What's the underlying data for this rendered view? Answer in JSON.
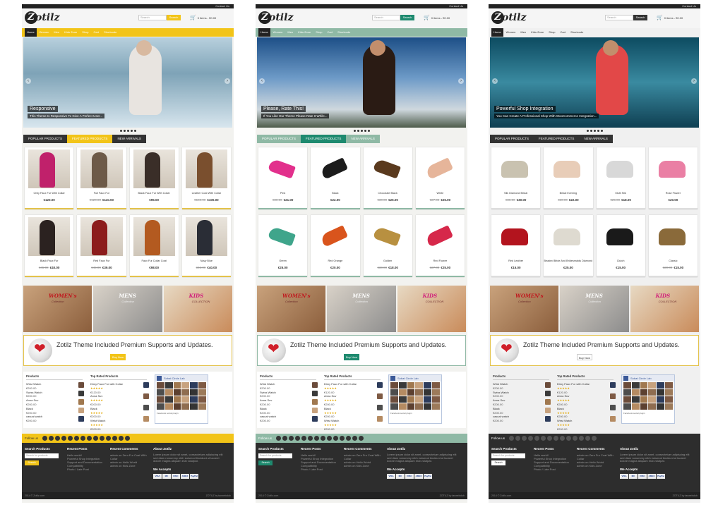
{
  "themes": [
    {
      "accent": "#f2c418",
      "nav_bg": "#f2c418",
      "contact": "Contact Us",
      "search_placeholder": "Search",
      "search_btn": "Search",
      "cart": "0 items - €0.00",
      "nav": [
        "Home",
        "Women",
        "Men",
        "Kids Zone",
        "Shop",
        "Cart",
        "Shortcode"
      ],
      "slide_title": "Responsive",
      "slide_sub": "This Theme Is Responsive To Give A Perfect User...",
      "tabs": [
        "POPULAR PRODUCTS",
        "FEATURED PRODUCTS",
        "NEW ARRIVALS"
      ],
      "products": [
        {
          "name": "Chily Faux Fur With Collar",
          "old": "",
          "price": "€120.00",
          "tone": "#c0216b"
        },
        {
          "name": "Full Faux Fur",
          "old": "€120.00",
          "price": "€110.00",
          "tone": "#6d5a48"
        },
        {
          "name": "Black Faux Fur With Collar",
          "old": "",
          "price": "€95.00",
          "tone": "#3a2e28"
        },
        {
          "name": "Leather Coat With Collar",
          "old": "€160.00",
          "price": "€100.00",
          "tone": "#7a4f2e"
        },
        {
          "name": "Black Faux Fur",
          "old": "€45.00",
          "price": "€40.00",
          "tone": "#2b2220"
        },
        {
          "name": "Red Faux Fur",
          "old": "€45.00",
          "price": "€39.00",
          "tone": "#8c1c1c"
        },
        {
          "name": "Faux Fur Collar Coat",
          "old": "",
          "price": "€98.00",
          "tone": "#b35a20"
        },
        {
          "name": "Navy Blue",
          "old": "€45.00",
          "price": "€40.00",
          "tone": "#2a2d36"
        }
      ],
      "promo": "Zotilz Theme Included Premium Supports and Updates.",
      "buy": "Buy Now",
      "widgets": {
        "products_title": "Products",
        "top_title": "Top Rated Products",
        "products": [
          {
            "n": "Wrist Watch",
            "p": "€200.00"
          },
          {
            "n": "Swiss Watch",
            "p": "€200.00"
          },
          {
            "n": "Anna Suv",
            "p": "€200.00"
          },
          {
            "n": "Black",
            "p": "€200.00"
          },
          {
            "n": "casual watch",
            "p": "€200.00"
          }
        ],
        "top": [
          {
            "n": "Dimy Faux Fur with Collar",
            "p": "€120.00"
          },
          {
            "n": "Anna Suv",
            "p": "€200.00"
          },
          {
            "n": "Black",
            "p": "€200.00"
          },
          {
            "n": "Wrist Watch",
            "p": "€200.00"
          }
        ],
        "fb_title": "Sobat Circle Lab",
        "fb_sub": "Facebook social plugin"
      },
      "follow": "Follow us",
      "footer": {
        "search_title": "Search Products",
        "search_ph": "Search for products",
        "search_btn": "Search",
        "posts_title": "Recent Posts",
        "posts": [
          "Hello world!",
          "Powerful Shop Integration",
          "Support and Documentation",
          "Compatibility",
          "Photo / Late Post"
        ],
        "comments_title": "Recent Comments",
        "comments": [
          "admin on Zero Fur Coat With Collar",
          "admin on Hello World",
          "admin on Kids Zone"
        ],
        "about_title": "About Zotilz",
        "about": "Lorem ipsum dolor sit amet, consectetuer adipiscing elit sed diam nonummy nibh euismod tincidunt ut laoreet dolore magna aliquam erat volutpat.",
        "accepts": "We Accepts",
        "pay": [
          "VISA",
          "MC",
          "DISC",
          "AMEX",
          "PayPal"
        ],
        "copy_l": "2014 © Zotilz.com",
        "copy_r": "ZOTILZ by tanwebclub"
      }
    },
    {
      "accent": "#1e8a6f",
      "nav_bg": "#8fb9a5",
      "contact": "Contact Us",
      "search_placeholder": "Search",
      "search_btn": "Search",
      "cart": "0 items - €0.00",
      "nav": [
        "Home",
        "Women",
        "Men",
        "Kids Zone",
        "Shop",
        "Cart",
        "Shortcode"
      ],
      "slide_title": "Please, Rate This!",
      "slide_sub": "If You Like Our Theme Please Rate It While...",
      "tabs": [
        "POPULAR PRODUCTS",
        "FEATURED PRODUCTS",
        "NEW ARRIVALS"
      ],
      "products": [
        {
          "name": "Pink",
          "old": "€30.00",
          "price": "€21.00",
          "tone": "#e2308c"
        },
        {
          "name": "Black",
          "old": "",
          "price": "€22.00",
          "tone": "#1c1c1c"
        },
        {
          "name": "Chocolate Black",
          "old": "€30.00",
          "price": "€25.00",
          "tone": "#5a3a1e"
        },
        {
          "name": "White",
          "old": "€27.00",
          "price": "€25.00",
          "tone": "#e6b59a"
        },
        {
          "name": "Green",
          "old": "",
          "price": "€25.00",
          "tone": "#3fa58b"
        },
        {
          "name": "Red Orange",
          "old": "",
          "price": "€20.00",
          "tone": "#d9541c"
        },
        {
          "name": "Golden",
          "old": "€30.00",
          "price": "€18.00",
          "tone": "#b89040"
        },
        {
          "name": "Red Flower",
          "old": "€27.00",
          "price": "€25.00",
          "tone": "#d6284a"
        }
      ],
      "promo": "Zotilz Theme Included Premium Supports and Updates.",
      "buy": "Buy Now",
      "widgets": {
        "products_title": "Products",
        "top_title": "Top Rated Products",
        "products": [
          {
            "n": "Wrist Watch",
            "p": "€200.00"
          },
          {
            "n": "Swiss Watch",
            "p": "€200.00"
          },
          {
            "n": "Anna Suv",
            "p": "€200.00"
          },
          {
            "n": "Black",
            "p": "€200.00"
          },
          {
            "n": "casual watch",
            "p": "€200.00"
          }
        ],
        "top": [
          {
            "n": "Dimy Faux Fur with Collar",
            "p": "€120.00"
          },
          {
            "n": "Anna Suv",
            "p": "€200.00"
          },
          {
            "n": "Black",
            "p": "€200.00"
          },
          {
            "n": "Wrist Watch",
            "p": "€200.00"
          }
        ],
        "fb_title": "Sobat Circle Lab",
        "fb_sub": "Facebook social plugin"
      },
      "follow": "Follow us",
      "footer": {
        "search_title": "Search Products",
        "search_ph": "Search for products",
        "search_btn": "Search",
        "posts_title": "Recent Posts",
        "posts": [
          "Hello world!",
          "Powerful Shop Integration",
          "Support and Documentation",
          "Compatibility",
          "Photo / Late Post"
        ],
        "comments_title": "Recent Comments",
        "comments": [
          "admin on Zero Fur Coat With Collar",
          "admin on Hello World",
          "admin on Kids Zone"
        ],
        "about_title": "About Zotilz",
        "about": "Lorem ipsum dolor sit amet, consectetuer adipiscing elit sed diam nonummy nibh euismod tincidunt ut laoreet dolore magna aliquam erat volutpat.",
        "accepts": "We Accepts",
        "pay": [
          "VISA",
          "MC",
          "DISC",
          "AMEX",
          "PayPal"
        ],
        "copy_l": "2014 © Zotilz.com",
        "copy_r": "ZOTILZ by tanwebclub"
      }
    },
    {
      "accent": "#333333",
      "nav_bg": "#f0f0f0",
      "contact": "Contact Us",
      "search_placeholder": "Search",
      "search_btn": "Search",
      "cart": "0 items - €0.00",
      "nav": [
        "Home",
        "Women",
        "Men",
        "Kids Zone",
        "Shop",
        "Cart",
        "Shortcode"
      ],
      "slide_title": "Powerful Shop Integration",
      "slide_sub": "You Can Create A Professional Shop With WooCommerce Integration...",
      "tabs": [
        "POPULAR PRODUCTS",
        "FEATURED PRODUCTS",
        "NEW ARRIVALS"
      ],
      "products": [
        {
          "name": "Silk Diamond Bridal",
          "old": "€35.00",
          "price": "€30.00",
          "tone": "#c9c2b0"
        },
        {
          "name": "Bridal Evening",
          "old": "€30.00",
          "price": "€22.00",
          "tone": "#e8cdb8"
        },
        {
          "name": "Multi Silk",
          "old": "€25.00",
          "price": "€18.00",
          "tone": "#d8d8d8"
        },
        {
          "name": "Rose Flower",
          "old": "",
          "price": "€20.00",
          "tone": "#ea7fa4"
        },
        {
          "name": "Red Leather",
          "old": "",
          "price": "€15.00",
          "tone": "#b3141e"
        },
        {
          "name": "Beaded Bride And Bridesmaids Diamond",
          "old": "",
          "price": "€25.00",
          "tone": "#dedad0"
        },
        {
          "name": "Clutch",
          "old": "",
          "price": "€15.00",
          "tone": "#1a1a1a"
        },
        {
          "name": "Classic",
          "old": "€20.00",
          "price": "€15.00",
          "tone": "#8a6a3a"
        }
      ],
      "promo": "Zotilz Theme Included Premium Supports and Updates.",
      "buy": "Buy Now",
      "widgets": {
        "products_title": "Products",
        "top_title": "Top Rated Products",
        "products": [
          {
            "n": "Wrist Watch",
            "p": "€200.00"
          },
          {
            "n": "Swiss Watch",
            "p": "€200.00"
          },
          {
            "n": "Anna Suv",
            "p": "€200.00"
          },
          {
            "n": "Black",
            "p": "€200.00"
          },
          {
            "n": "casual watch",
            "p": "€200.00"
          }
        ],
        "top": [
          {
            "n": "Dimy Faux Fur with Collar",
            "p": "€120.00"
          },
          {
            "n": "Anna Suv",
            "p": "€200.00"
          },
          {
            "n": "Black",
            "p": "€200.00"
          },
          {
            "n": "Wrist Watch",
            "p": "€200.00"
          }
        ],
        "fb_title": "Sobat Circle Lab",
        "fb_sub": "Facebook social plugin"
      },
      "follow": "Follow us",
      "footer": {
        "search_title": "Search Products",
        "search_ph": "Search for products",
        "search_btn": "Search",
        "posts_title": "Recent Posts",
        "posts": [
          "Hello world!",
          "Powerful Shop Integration",
          "Support and Documentation",
          "Compatibility",
          "Photo / Late Post"
        ],
        "comments_title": "Recent Comments",
        "comments": [
          "admin on Zero Fur Coat With Collar",
          "admin on Hello World",
          "admin on Kids Zone"
        ],
        "about_title": "About Zotilz",
        "about": "Lorem ipsum dolor sit amet, consectetuer adipiscing elit sed diam nonummy nibh euismod tincidunt ut laoreet dolore magna aliquam erat volutpat.",
        "accepts": "We Accepts",
        "pay": [
          "VISA",
          "MC",
          "DISC",
          "AMEX",
          "PayPal"
        ],
        "copy_l": "2014 © Zotilz.com",
        "copy_r": "ZOTILZ by tanwebclub"
      }
    }
  ],
  "brand": "otilz",
  "brand_mark": "Z",
  "banners": [
    "WOMEN's",
    "Collection",
    "MENS",
    "Collection",
    "KIDS",
    "COLLECTION"
  ]
}
